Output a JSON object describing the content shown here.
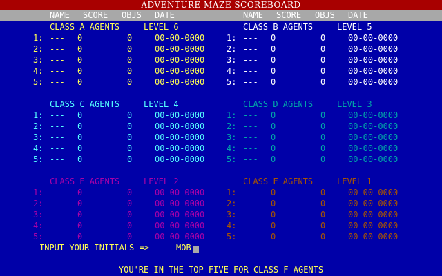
{
  "title": "ADVENTURE MAZE SCOREBOARD",
  "column_headers": [
    "NAME",
    "SCORE",
    "OBJS",
    "DATE"
  ],
  "colors": {
    "background": "#0000a8",
    "title_bar": "#a80000",
    "header_strip": "#a8a8a8",
    "class_a": "#ffff55",
    "class_b": "#ffffff",
    "class_c": "#55ffff",
    "class_d": "#00a8a8",
    "class_e": "#a800a8",
    "class_f": "#a85400",
    "prompt": "#ffff55"
  },
  "classes": [
    {
      "label": "CLASS A AGENTS",
      "level": "LEVEL 6",
      "color": "#ffff55",
      "entries": [
        {
          "rank": "1:",
          "name": "---",
          "score": "0",
          "objs": "0",
          "date": "00-00-0000"
        },
        {
          "rank": "2:",
          "name": "---",
          "score": "0",
          "objs": "0",
          "date": "00-00-0000"
        },
        {
          "rank": "3:",
          "name": "---",
          "score": "0",
          "objs": "0",
          "date": "00-00-0000"
        },
        {
          "rank": "4:",
          "name": "---",
          "score": "0",
          "objs": "0",
          "date": "00-00-0000"
        },
        {
          "rank": "5:",
          "name": "---",
          "score": "0",
          "objs": "0",
          "date": "00-00-0000"
        }
      ]
    },
    {
      "label": "CLASS B AGENTS",
      "level": "LEVEL 5",
      "color": "#ffffff",
      "entries": [
        {
          "rank": "1:",
          "name": "---",
          "score": "0",
          "objs": "0",
          "date": "00-00-0000"
        },
        {
          "rank": "2:",
          "name": "---",
          "score": "0",
          "objs": "0",
          "date": "00-00-0000"
        },
        {
          "rank": "3:",
          "name": "---",
          "score": "0",
          "objs": "0",
          "date": "00-00-0000"
        },
        {
          "rank": "4:",
          "name": "---",
          "score": "0",
          "objs": "0",
          "date": "00-00-0000"
        },
        {
          "rank": "5:",
          "name": "---",
          "score": "0",
          "objs": "0",
          "date": "00-00-0000"
        }
      ]
    },
    {
      "label": "CLASS C AGENTS",
      "level": "LEVEL 4",
      "color": "#55ffff",
      "entries": [
        {
          "rank": "1:",
          "name": "---",
          "score": "0",
          "objs": "0",
          "date": "00-00-0000"
        },
        {
          "rank": "2:",
          "name": "---",
          "score": "0",
          "objs": "0",
          "date": "00-00-0000"
        },
        {
          "rank": "3:",
          "name": "---",
          "score": "0",
          "objs": "0",
          "date": "00-00-0000"
        },
        {
          "rank": "4:",
          "name": "---",
          "score": "0",
          "objs": "0",
          "date": "00-00-0000"
        },
        {
          "rank": "5:",
          "name": "---",
          "score": "0",
          "objs": "0",
          "date": "00-00-0000"
        }
      ]
    },
    {
      "label": "CLASS D AGENTS",
      "level": "LEVEL 3",
      "color": "#00a8a8",
      "entries": [
        {
          "rank": "1:",
          "name": "---",
          "score": "0",
          "objs": "0",
          "date": "00-00-0000"
        },
        {
          "rank": "2:",
          "name": "---",
          "score": "0",
          "objs": "0",
          "date": "00-00-0000"
        },
        {
          "rank": "3:",
          "name": "---",
          "score": "0",
          "objs": "0",
          "date": "00-00-0000"
        },
        {
          "rank": "4:",
          "name": "---",
          "score": "0",
          "objs": "0",
          "date": "00-00-0000"
        },
        {
          "rank": "5:",
          "name": "---",
          "score": "0",
          "objs": "0",
          "date": "00-00-0000"
        }
      ]
    },
    {
      "label": "CLASS E AGENTS",
      "level": "LEVEL 2",
      "color": "#a800a8",
      "entries": [
        {
          "rank": "1:",
          "name": "---",
          "score": "0",
          "objs": "0",
          "date": "00-00-0000"
        },
        {
          "rank": "2:",
          "name": "---",
          "score": "0",
          "objs": "0",
          "date": "00-00-0000"
        },
        {
          "rank": "3:",
          "name": "---",
          "score": "0",
          "objs": "0",
          "date": "00-00-0000"
        },
        {
          "rank": "4:",
          "name": "---",
          "score": "0",
          "objs": "0",
          "date": "00-00-0000"
        },
        {
          "rank": "5:",
          "name": "---",
          "score": "0",
          "objs": "0",
          "date": "00-00-0000"
        }
      ]
    },
    {
      "label": "CLASS F AGENTS",
      "level": "LEVEL 1",
      "color": "#a85400",
      "entries": [
        {
          "rank": "1:",
          "name": "---",
          "score": "0",
          "objs": "0",
          "date": "00-00-0000"
        },
        {
          "rank": "2:",
          "name": "---",
          "score": "0",
          "objs": "0",
          "date": "00-00-0000"
        },
        {
          "rank": "3:",
          "name": "---",
          "score": "0",
          "objs": "0",
          "date": "00-00-0000"
        },
        {
          "rank": "4:",
          "name": "---",
          "score": "0",
          "objs": "0",
          "date": "00-00-0000"
        },
        {
          "rank": "5:",
          "name": "---",
          "score": "0",
          "objs": "0",
          "date": "00-00-0000"
        }
      ]
    }
  ],
  "prompt": {
    "label": "INPUT YOUR INITIALS =>",
    "value": "MOB"
  },
  "status_message": "YOU'RE IN THE TOP FIVE FOR CLASS F AGENTS"
}
